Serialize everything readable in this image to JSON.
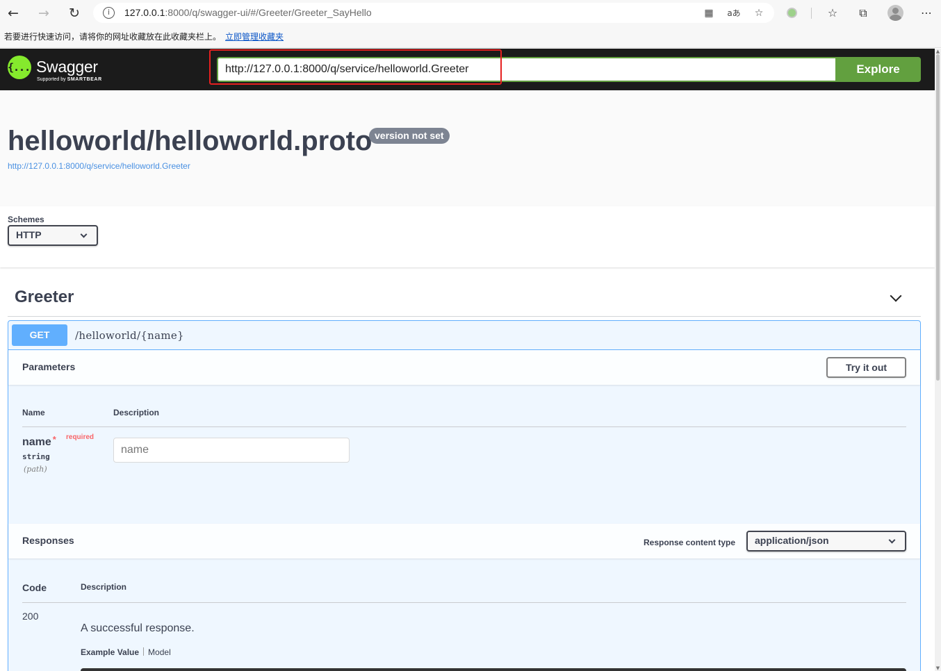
{
  "browser": {
    "url_host": "127.0.0.1",
    "url_rest": ":8000/q/swagger-ui/#/Greeter/Greeter_SayHello",
    "favorites_hint": "若要进行快速访问，请将你的网址收藏放在此收藏夹栏上。",
    "favorites_link": "立即管理收藏夹"
  },
  "topbar": {
    "logo_mark": "{...}",
    "logo_title": "Swagger",
    "logo_sub_prefix": "Supported by",
    "logo_sub_brand": "SMARTBEAR",
    "url_value": "http://127.0.0.1:8000/q/service/helloworld.Greeter",
    "explore_label": "Explore",
    "accent_color": "#62a03f",
    "highlight_color": "#e62020"
  },
  "info": {
    "title": "helloworld/helloworld.proto",
    "version": "version not set",
    "url": "http://127.0.0.1:8000/q/service/helloworld.Greeter"
  },
  "schemes": {
    "label": "Schemes",
    "selected": "HTTP"
  },
  "tag": {
    "name": "Greeter"
  },
  "operation": {
    "method": "GET",
    "method_color": "#61affe",
    "path": "/helloworld/{name}",
    "parameters_title": "Parameters",
    "try_label": "Try it out",
    "col_name": "Name",
    "col_description": "Description",
    "param": {
      "name": "name",
      "star": "*",
      "required": "required",
      "type": "string",
      "in": "(path)",
      "placeholder": "name"
    },
    "responses_title": "Responses",
    "response_content_type_label": "Response content type",
    "response_content_type": "application/json",
    "col_code": "Code",
    "col_resp_description": "Description",
    "response": {
      "code": "200",
      "description": "A successful response.",
      "tab_example": "Example Value",
      "tab_model": "Model"
    }
  }
}
